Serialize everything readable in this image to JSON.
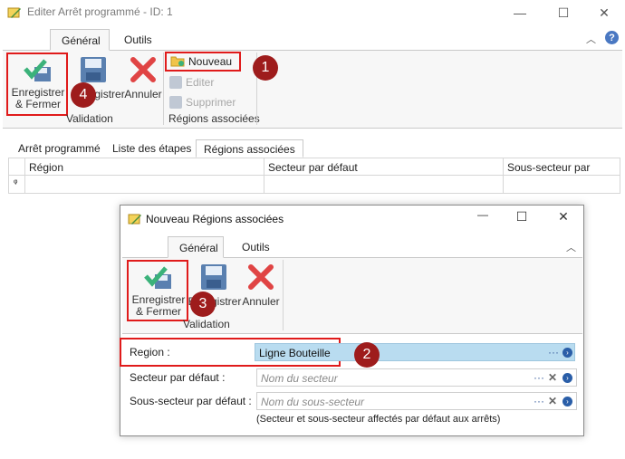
{
  "window": {
    "title": "Editer Arrêt programmé - ID: 1",
    "tabs": [
      "Général",
      "Outils"
    ]
  },
  "ribbon": {
    "save_close_label": "Enregistrer & Fermer",
    "save_label": "Enregistrer",
    "cancel_label": "Annuler",
    "validation_group": "Validation",
    "new_label": "Nouveau",
    "edit_label": "Editer",
    "delete_label": "Supprimer",
    "regions_group": "Régions associées"
  },
  "subtabs": [
    "Arrêt programmé",
    "Liste des étapes",
    "Régions associées"
  ],
  "grid": {
    "columns": [
      "Région",
      "Secteur par défaut",
      "Sous-secteur par défaut"
    ],
    "filter_icon": "ᵠ"
  },
  "dialog": {
    "title": "Nouveau Régions associées",
    "tabs": [
      "Général",
      "Outils"
    ],
    "save_close_label": "Enregistrer & Fermer",
    "save_label": "Enregistrer",
    "cancel_label": "Annuler",
    "validation_group": "Validation",
    "fields": {
      "region_label": "Region :",
      "region_value": "Ligne Bouteille",
      "sector_label": "Secteur par défaut :",
      "sector_placeholder": "Nom du secteur",
      "subsector_label": "Sous-secteur par défaut :",
      "subsector_placeholder": "Nom du sous-secteur",
      "hint": "(Secteur et sous-secteur affectés par défaut aux arrêts)"
    }
  },
  "badges": [
    "1",
    "2",
    "3",
    "4"
  ],
  "colors": {
    "highlight_red": "#e01b1b",
    "badge": "#9e1c1c",
    "accent_blue": "#2a5ea8",
    "selection": "#b9dcf0"
  }
}
